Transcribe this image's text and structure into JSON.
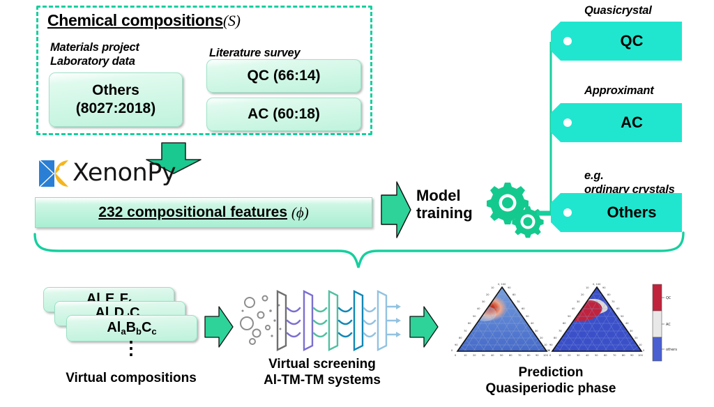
{
  "accent": {
    "green": "#16cf9e",
    "green_dark": "#0fae85",
    "turquoise": "#21e6cf",
    "mint_fill": "#bff3dd",
    "qc_red": "#c0233c",
    "ac_gray": "#d9d9d9",
    "others_blue": "#3b50c8"
  },
  "input_section": {
    "title_main": "Chemical compositions",
    "title_symbol": "(S)",
    "source_left": "Materials project\nLaboratory data",
    "source_right": "Literature survey",
    "cards": {
      "others_label": "Others",
      "others_counts": "(8027:2018)",
      "qc": "QC (66:14)",
      "ac": "AC (60:18)"
    }
  },
  "featurization": {
    "brand": "XenonPy",
    "logo_icon": "xenonpy-logo-icon",
    "features_count": "232 compositional features",
    "features_symbol": "(ϕ)",
    "down_arrow_icon": "down-arrow-icon"
  },
  "model": {
    "label_line1": "Model",
    "label_line2": "training",
    "gears_icon": "gears-icon",
    "arrow_icon": "right-arrow-icon"
  },
  "outputs": [
    {
      "caption": "Quasicrystal",
      "label": "QC",
      "name": "tag-qc"
    },
    {
      "caption": "Approximant",
      "label": "AC",
      "name": "tag-ac"
    },
    {
      "caption": "e.g.\nordinary crystals",
      "label": "Others",
      "name": "tag-others"
    }
  ],
  "virtual": {
    "cards": [
      {
        "prefix": "Al",
        "s1": "a",
        "m": "E",
        "s2": "e",
        "t": "F",
        "s3": "f"
      },
      {
        "prefix": "Al",
        "s1": "a",
        "m": "D",
        "s2": "d",
        "t": "C",
        "s3": "c"
      },
      {
        "prefix": "Al",
        "s1": "a",
        "m": "B",
        "s2": "b",
        "t": "C",
        "s3": "c"
      }
    ],
    "ellipsis": "⋮",
    "caption": "Virtual compositions"
  },
  "screening": {
    "icon": "neural-screening-icon",
    "caption_line1": "Virtual screening",
    "caption_line2": "Al-TM-TM systems"
  },
  "prediction": {
    "caption_line1": "Prediction",
    "caption_line2": "Quasiperiodic phase",
    "colorbar": {
      "qc": "QC",
      "ac": "AC",
      "others": "others"
    }
  },
  "chart_data": [
    {
      "type": "heatmap",
      "name": "ternary-probability-heatmap",
      "title": "",
      "projection": "ternary",
      "axes": {
        "bottom": {
          "ticks": [
            0,
            10,
            20,
            30,
            40,
            50,
            60,
            70,
            80,
            90,
            100
          ]
        },
        "left": {
          "ticks": [
            0,
            10,
            20,
            30,
            40,
            50,
            60,
            70,
            80,
            90,
            100
          ]
        },
        "right": {
          "ticks": [
            0,
            10,
            20,
            30,
            40,
            50,
            60,
            70,
            80,
            90,
            100
          ]
        }
      },
      "apex_label": "0, 100",
      "grid": true,
      "colormap": "coolwarm",
      "description": "Continuous predicted probability over Al-TM-TM ternary space; blue background with a red/orange high-probability hotspot near the upper-left region.",
      "hotspot": {
        "center_xy": [
          0.38,
          0.62
        ],
        "peak_value": 0.95,
        "radius": 0.14
      },
      "background_value": 0.18
    },
    {
      "type": "heatmap",
      "name": "ternary-classified-regions",
      "title": "",
      "projection": "ternary",
      "axes": {
        "bottom": {
          "ticks": [
            0,
            10,
            20,
            30,
            40,
            50,
            60,
            70,
            80,
            90,
            100
          ]
        },
        "left": {
          "ticks": [
            0,
            10,
            20,
            30,
            40,
            50,
            60,
            70,
            80,
            90,
            100
          ]
        },
        "right": {
          "ticks": [
            0,
            10,
            20,
            30,
            40,
            50,
            60,
            70,
            80,
            90,
            100
          ]
        }
      },
      "apex_label": "0, 100",
      "grid": true,
      "description": "Discrete predicted class regions: crimson QC blob upper-left, gray AC band to its upper-right, blue 'others' filling the remainder.",
      "classes": [
        {
          "label": "QC",
          "color": "#c0233c",
          "area_fraction": 0.09
        },
        {
          "label": "AC",
          "color": "#d9d9d9",
          "area_fraction": 0.04
        },
        {
          "label": "others",
          "color": "#3b50c8",
          "area_fraction": 0.87
        }
      ]
    },
    {
      "type": "bar",
      "name": "class-colorbar",
      "orientation": "vertical",
      "categories": [
        "QC",
        "AC",
        "others"
      ],
      "values": [
        1,
        1,
        1
      ],
      "colors": [
        "#c0233c",
        "#e8e8e8",
        "#4a5fd0"
      ],
      "title": "",
      "description": "Three-band discrete colorbar legend mapping class colors to names."
    }
  ]
}
